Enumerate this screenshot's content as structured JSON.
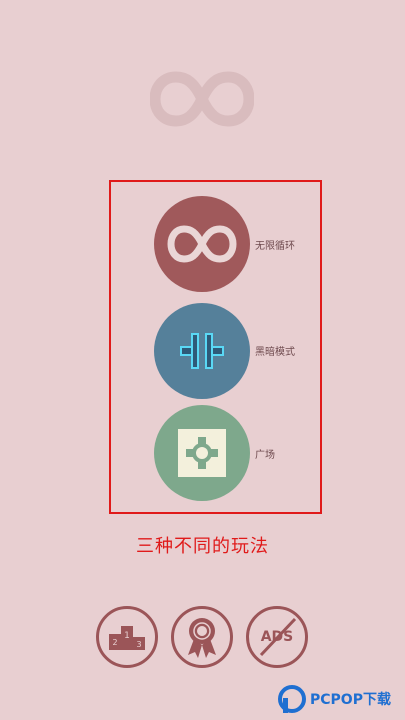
{
  "header": {
    "logo_icon": "infinity-icon"
  },
  "modes": [
    {
      "label": "无限循环",
      "icon": "infinity-icon",
      "color": "#a0595b"
    },
    {
      "label": "黑暗模式",
      "icon": "split-bars-icon",
      "color": "#55809a"
    },
    {
      "label": "广场",
      "icon": "cross-puzzle-icon",
      "color": "#7ea88c"
    }
  ],
  "caption": "三种不同的玩法",
  "bottom_bar": {
    "leaderboard_icon": "podium-icon",
    "achievements_icon": "award-ribbon-icon",
    "remove_ads_label": "ADS"
  },
  "watermark": {
    "text": "PCPOP下载"
  },
  "colors": {
    "background": "#e8cfd1",
    "accent_red": "#e01a1a",
    "button_outline": "#9b5558",
    "neon_blue": "#5ad8f5"
  }
}
